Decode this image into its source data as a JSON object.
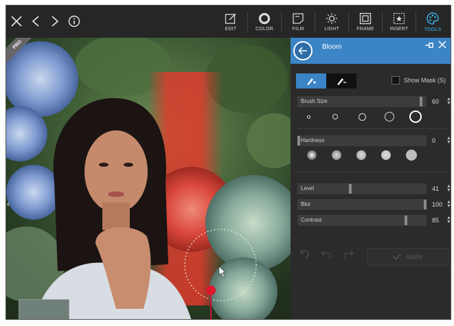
{
  "toolbar": {
    "left_icons": [
      "close-icon",
      "back-icon",
      "forward-icon",
      "info-icon"
    ],
    "tools": [
      {
        "label": "EDIT",
        "icon": "edit-icon",
        "active": false
      },
      {
        "label": "COLOR",
        "icon": "color-icon",
        "active": false
      },
      {
        "label": "FILM",
        "icon": "film-icon",
        "active": false
      },
      {
        "label": "LIGHT",
        "icon": "light-icon",
        "active": false
      },
      {
        "label": "FRAME",
        "icon": "frame-icon",
        "active": false
      },
      {
        "label": "INSERT",
        "icon": "insert-icon",
        "active": false
      },
      {
        "label": "TOOLS",
        "icon": "tools-icon",
        "active": true
      }
    ]
  },
  "photo": {
    "badge": "PRO",
    "description_icons": [
      "brush-cursor-icon",
      "thumbnail-icon"
    ]
  },
  "panel": {
    "title": "Bloom",
    "show_mask_label": "Show Mask (S)",
    "brush_size": {
      "label": "Brush Size",
      "value": "60",
      "fraction": 0.97
    },
    "hardness": {
      "label": "Hardness",
      "value": "0",
      "fraction": 0.0
    },
    "level": {
      "label": "Level",
      "value": "41",
      "fraction": 0.41
    },
    "blur": {
      "label": "Blur",
      "value": "100",
      "fraction": 1.0
    },
    "contrast": {
      "label": "Contrast",
      "value": "85",
      "fraction": 0.85
    },
    "apply_label": "Apply"
  },
  "colors": {
    "accent": "#3b84c6",
    "active_tool": "#3cb3f4",
    "panel_bg": "#2b2b2b",
    "marker": "#e0152e"
  }
}
